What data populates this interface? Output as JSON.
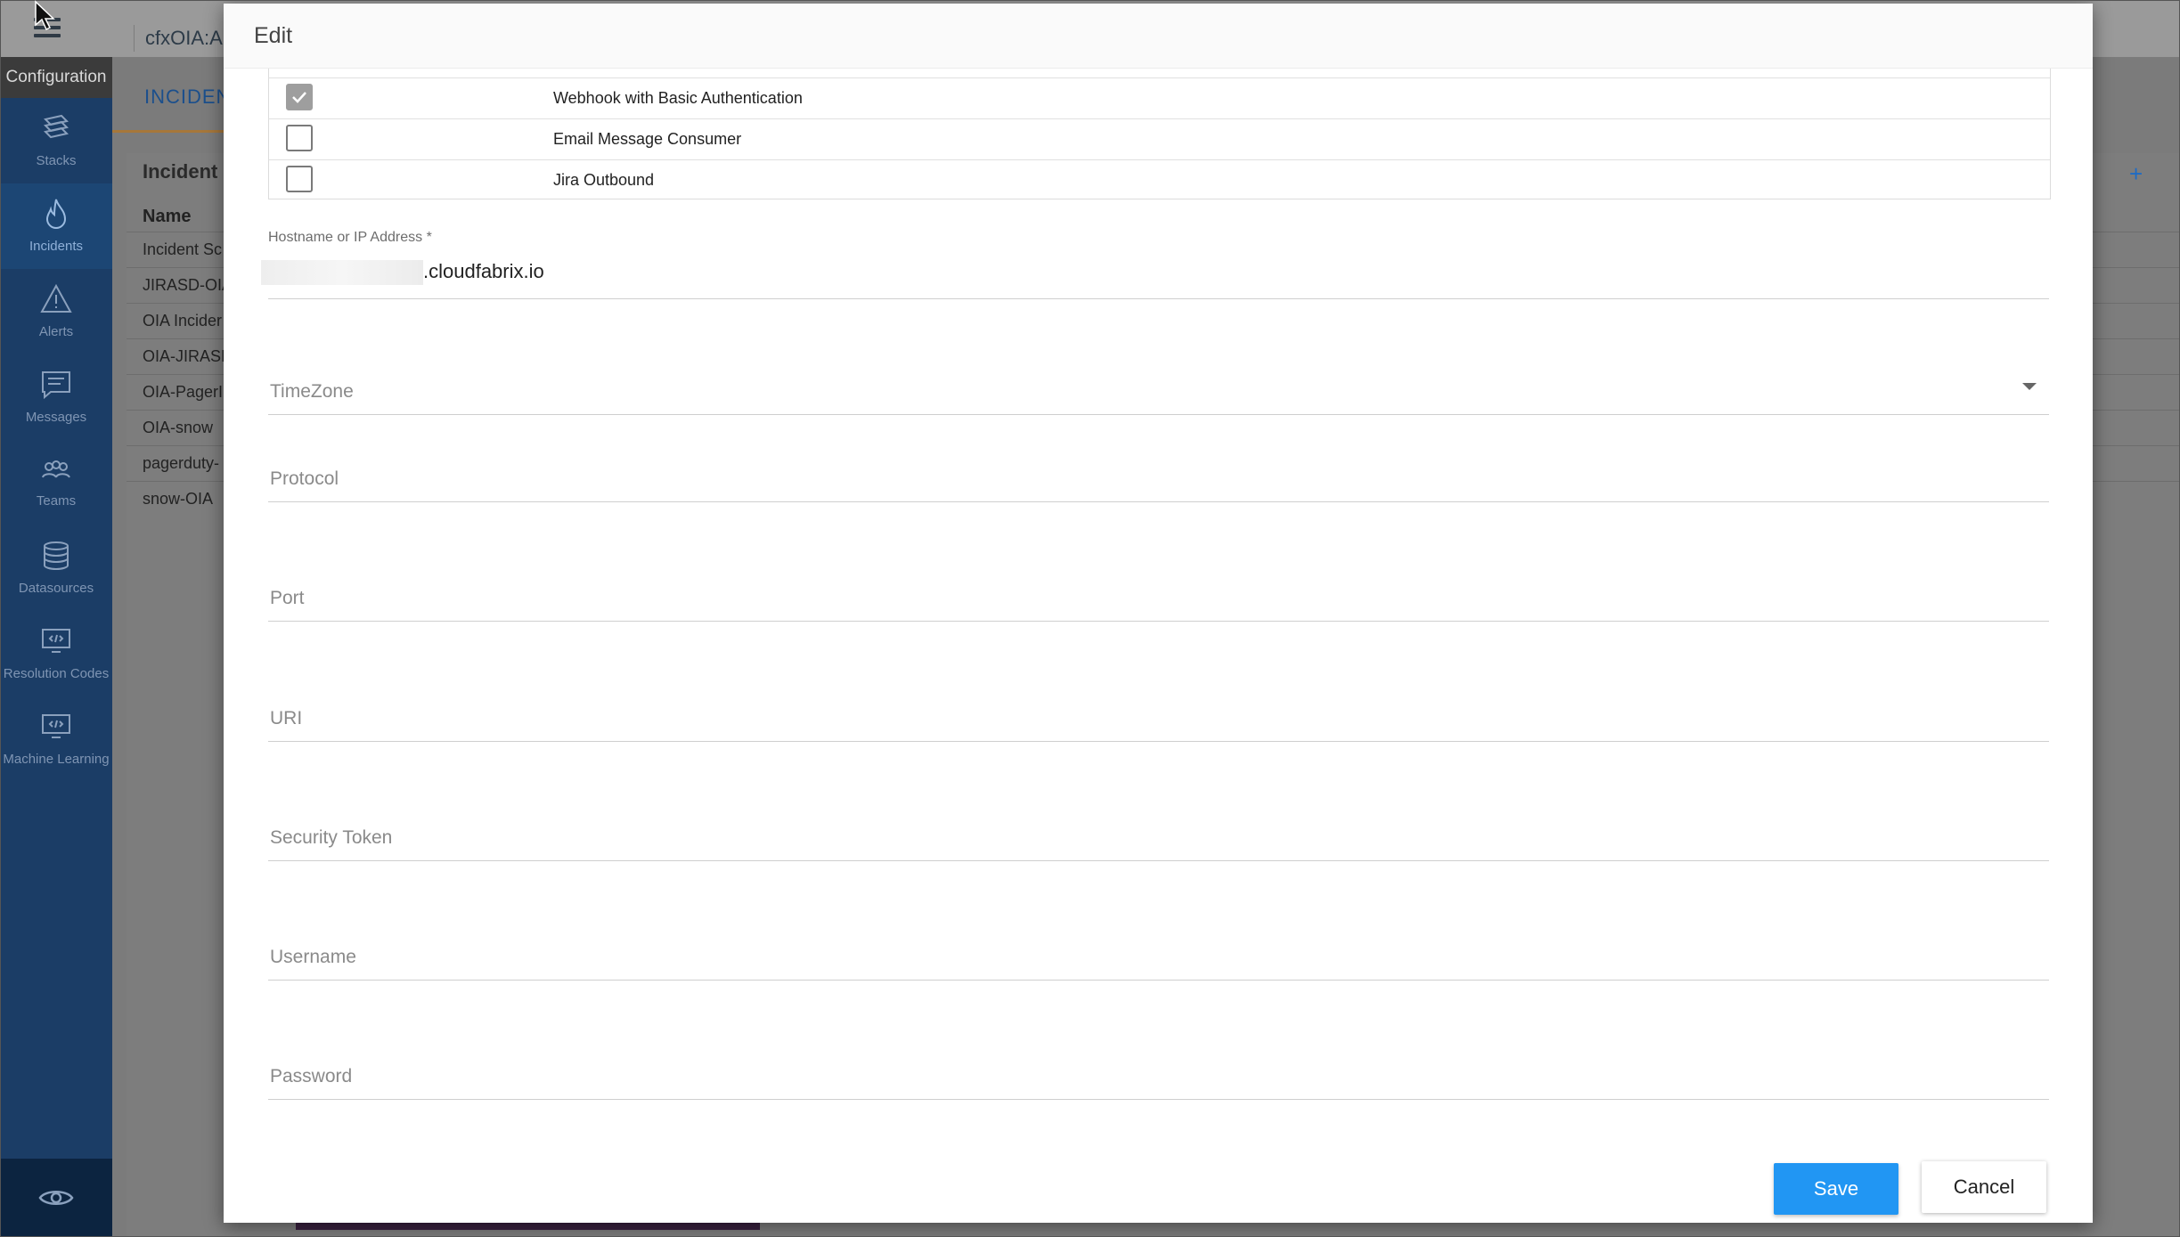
{
  "app": {
    "title": "cfxOIA:A",
    "section": "Configuration",
    "tab": "INCIDENT",
    "panel_title": "Incident I",
    "column_header": "Name",
    "rows": [
      "Incident Sc",
      "JIRASD-OIA",
      "OIA Incider",
      "OIA-JIRASI",
      "OIA-PagerI",
      "OIA-snow",
      "pagerduty-",
      "snow-OIA"
    ]
  },
  "nav": [
    {
      "label": "Stacks",
      "icon": "stacks-icon",
      "active": false
    },
    {
      "label": "Incidents",
      "icon": "incidents-icon",
      "active": true
    },
    {
      "label": "Alerts",
      "icon": "alert-triangle-icon",
      "active": false
    },
    {
      "label": "Messages",
      "icon": "message-icon",
      "active": false
    },
    {
      "label": "Teams",
      "icon": "teams-icon",
      "active": false
    },
    {
      "label": "Datasources",
      "icon": "database-icon",
      "active": false
    },
    {
      "label": "Resolution Codes",
      "icon": "code-monitor-icon",
      "active": false
    },
    {
      "label": "Machine Learning",
      "icon": "code-monitor-icon",
      "active": false
    }
  ],
  "modal": {
    "title": "Edit",
    "destinations": [
      {
        "label": "",
        "checked": false
      },
      {
        "label": "Webhook with Basic Authentication",
        "checked": true
      },
      {
        "label": "Email Message Consumer",
        "checked": false
      },
      {
        "label": "Jira Outbound",
        "checked": false
      }
    ],
    "hostname": {
      "label": "Hostname or IP Address *",
      "value_suffix": ".cloudfabrix.io"
    },
    "timezone": {
      "placeholder": "TimeZone"
    },
    "protocol": {
      "placeholder": "Protocol"
    },
    "port": {
      "placeholder": "Port"
    },
    "uri": {
      "placeholder": "URI"
    },
    "security_token": {
      "placeholder": "Security Token"
    },
    "username": {
      "placeholder": "Username"
    },
    "password": {
      "placeholder": "Password"
    },
    "save_label": "Save",
    "cancel_label": "Cancel"
  },
  "colors": {
    "sidebar": "#1b3d66",
    "primary_button": "#2196f3",
    "checkbox_checked": "#9e9e9e"
  }
}
